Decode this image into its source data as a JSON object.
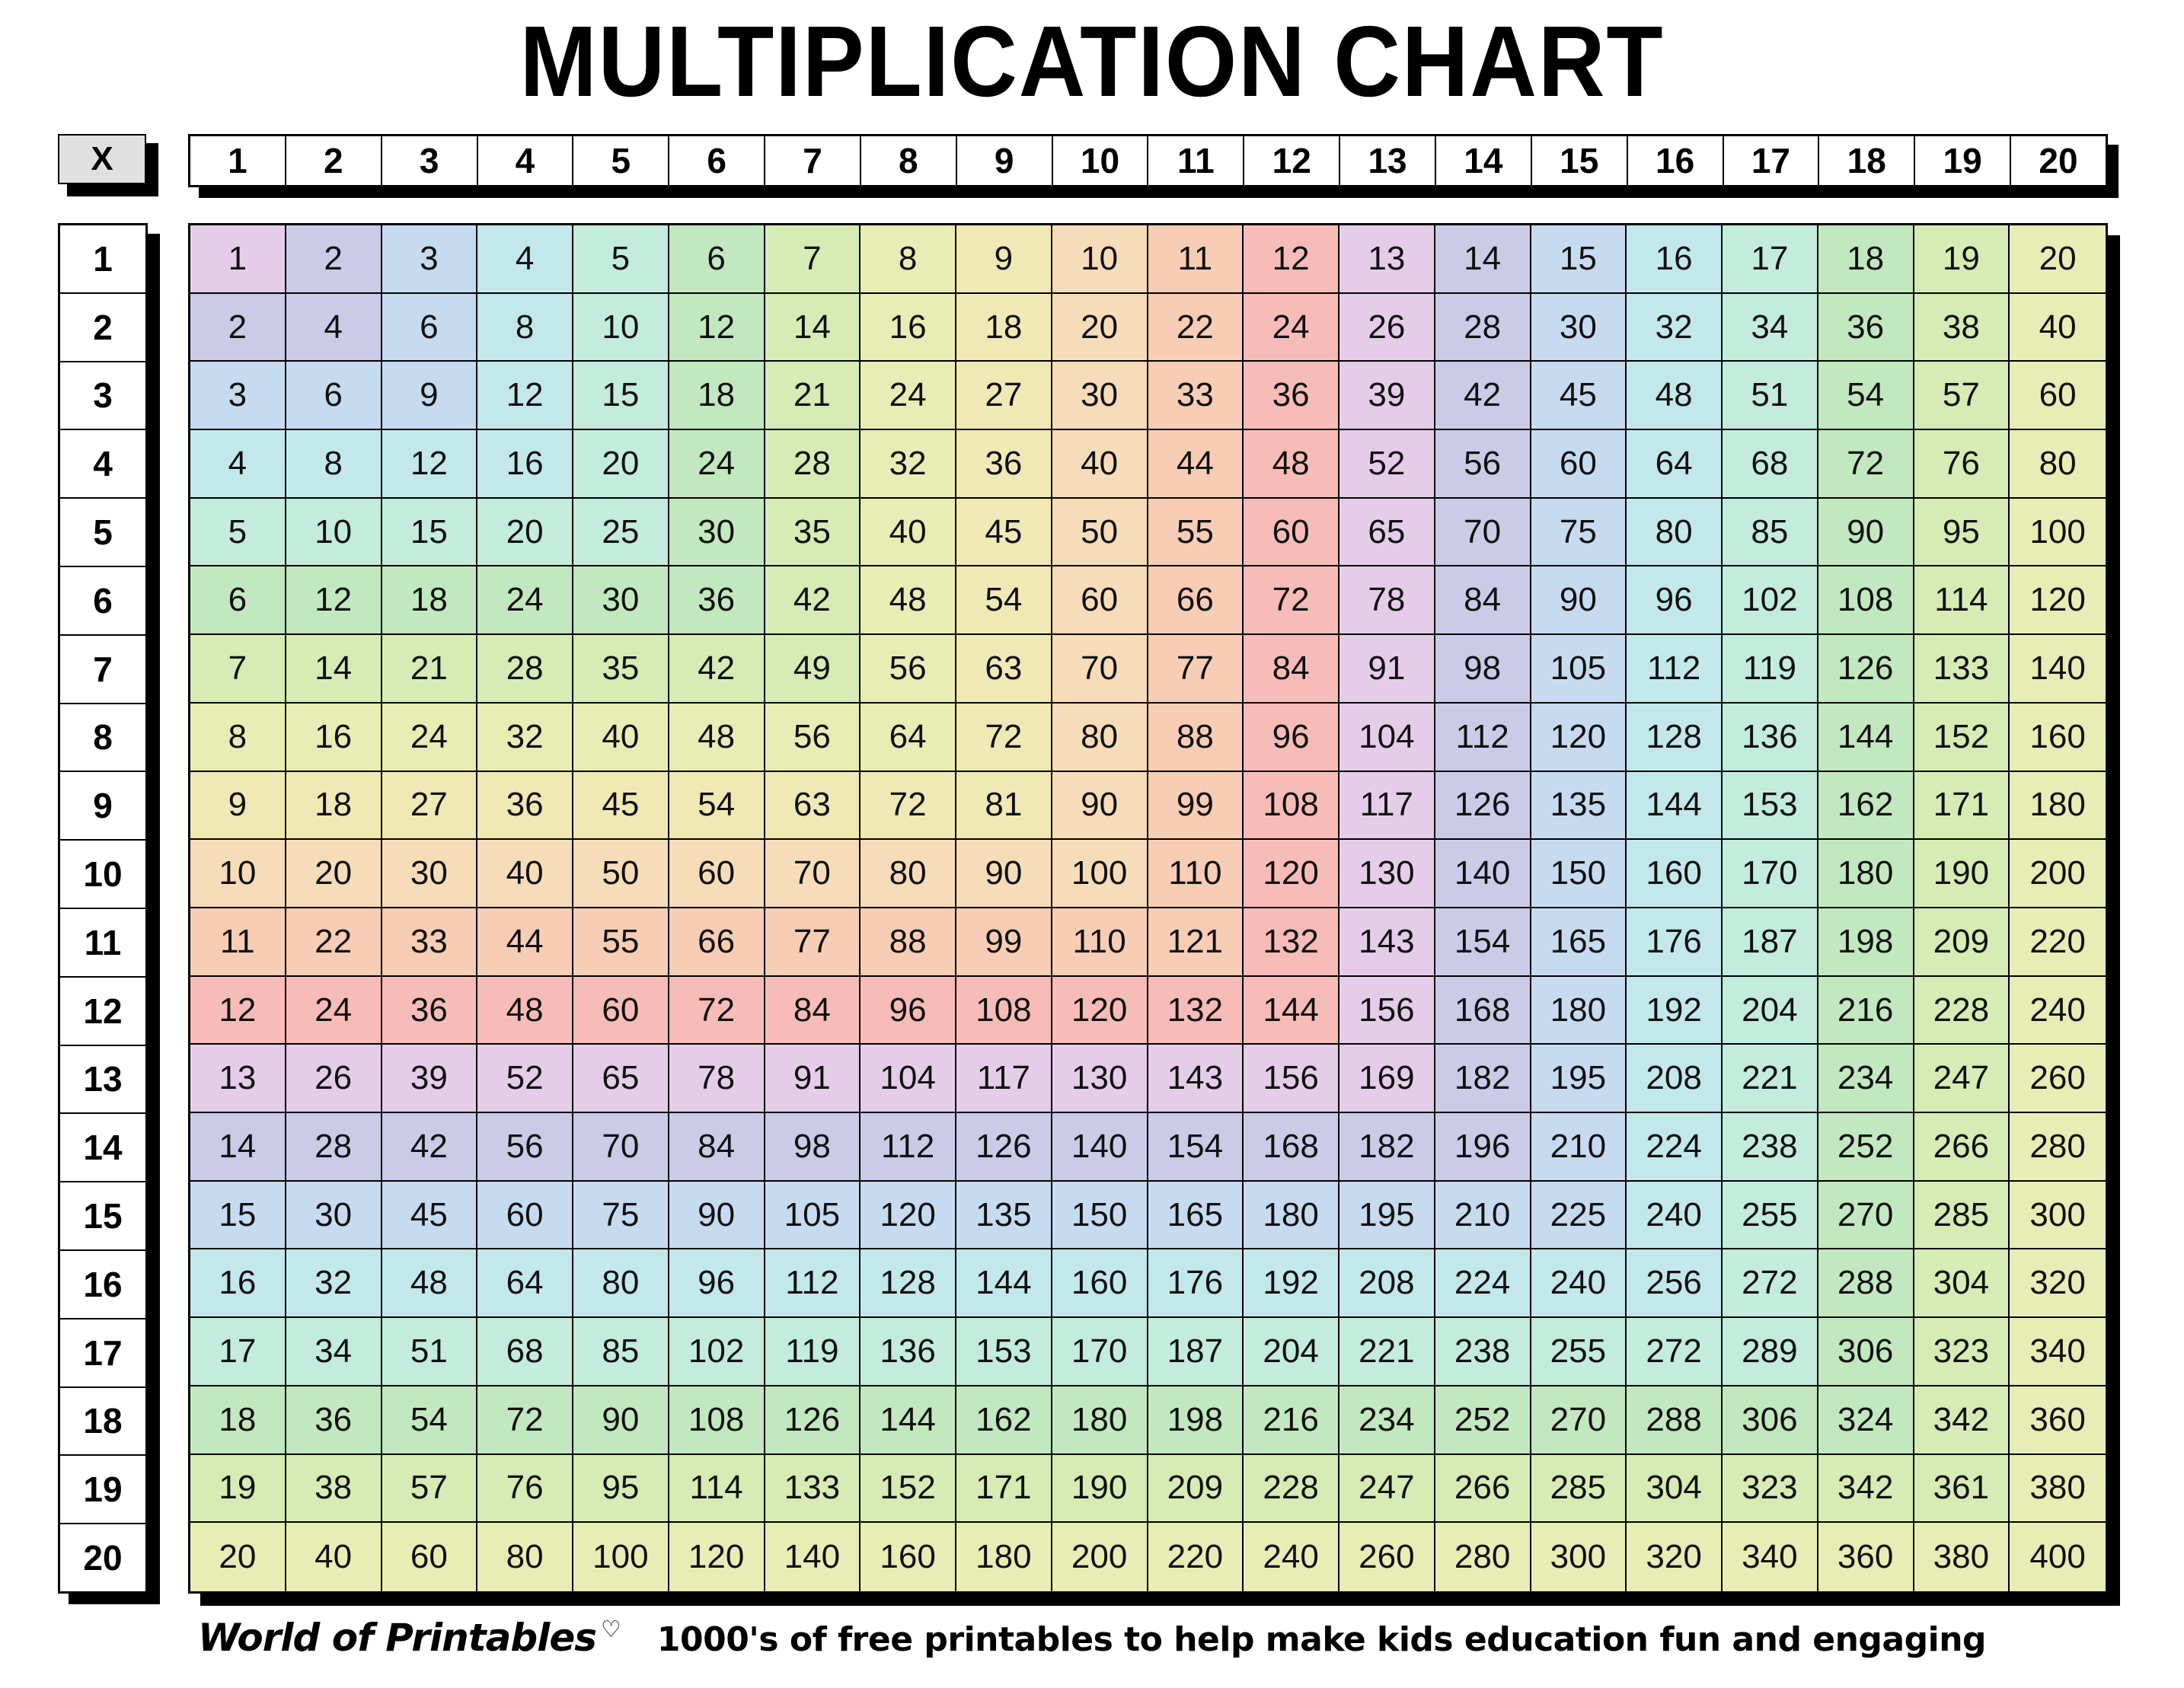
{
  "title": "MULTIPLICATION CHART",
  "corner_label": "X",
  "footer": {
    "brand": "World of Printables",
    "heart_icon": "♡",
    "tagline": "1000's of free printables to help make kids education fun and engaging"
  },
  "palette": {
    "corner_fill": "#e0e0e0",
    "header_fill": "#ffffff",
    "border": "#000000",
    "shadow": "#000000",
    "rainbow": [
      "#e5cdea",
      "#cbcbe8",
      "#c7dbf0",
      "#c3e8ec",
      "#c3ecdc",
      "#c2e8bf",
      "#d6ecb4",
      "#e8edb6",
      "#f0e9b6",
      "#f7dcb9",
      "#f8cdb5",
      "#f8bcb8"
    ]
  },
  "chart_data": {
    "type": "table",
    "title": "MULTIPLICATION CHART",
    "xlabel": "",
    "ylabel": "",
    "corner_label": "X",
    "grid": true,
    "legend": "none",
    "color_rule": "cell background index = max(row, col) mod 12 over a 12-step pastel rainbow",
    "columns": [
      1,
      2,
      3,
      4,
      5,
      6,
      7,
      8,
      9,
      10,
      11,
      12,
      13,
      14,
      15,
      16,
      17,
      18,
      19,
      20
    ],
    "rows": [
      1,
      2,
      3,
      4,
      5,
      6,
      7,
      8,
      9,
      10,
      11,
      12,
      13,
      14,
      15,
      16,
      17,
      18,
      19,
      20
    ],
    "values": [
      [
        1,
        2,
        3,
        4,
        5,
        6,
        7,
        8,
        9,
        10,
        11,
        12,
        13,
        14,
        15,
        16,
        17,
        18,
        19,
        20
      ],
      [
        2,
        4,
        6,
        8,
        10,
        12,
        14,
        16,
        18,
        20,
        22,
        24,
        26,
        28,
        30,
        32,
        34,
        36,
        38,
        40
      ],
      [
        3,
        6,
        9,
        12,
        15,
        18,
        21,
        24,
        27,
        30,
        33,
        36,
        39,
        42,
        45,
        48,
        51,
        54,
        57,
        60
      ],
      [
        4,
        8,
        12,
        16,
        20,
        24,
        28,
        32,
        36,
        40,
        44,
        48,
        52,
        56,
        60,
        64,
        68,
        72,
        76,
        80
      ],
      [
        5,
        10,
        15,
        20,
        25,
        30,
        35,
        40,
        45,
        50,
        55,
        60,
        65,
        70,
        75,
        80,
        85,
        90,
        95,
        100
      ],
      [
        6,
        12,
        18,
        24,
        30,
        36,
        42,
        48,
        54,
        60,
        66,
        72,
        78,
        84,
        90,
        96,
        102,
        108,
        114,
        120
      ],
      [
        7,
        14,
        21,
        28,
        35,
        42,
        49,
        56,
        63,
        70,
        77,
        84,
        91,
        98,
        105,
        112,
        119,
        126,
        133,
        140
      ],
      [
        8,
        16,
        24,
        32,
        40,
        48,
        56,
        64,
        72,
        80,
        88,
        96,
        104,
        112,
        120,
        128,
        136,
        144,
        152,
        160
      ],
      [
        9,
        18,
        27,
        36,
        45,
        54,
        63,
        72,
        81,
        90,
        99,
        108,
        117,
        126,
        135,
        144,
        153,
        162,
        171,
        180
      ],
      [
        10,
        20,
        30,
        40,
        50,
        60,
        70,
        80,
        90,
        100,
        110,
        120,
        130,
        140,
        150,
        160,
        170,
        180,
        190,
        200
      ],
      [
        11,
        22,
        33,
        44,
        55,
        66,
        77,
        88,
        99,
        110,
        121,
        132,
        143,
        154,
        165,
        176,
        187,
        198,
        209,
        220
      ],
      [
        12,
        24,
        36,
        48,
        60,
        72,
        84,
        96,
        108,
        120,
        132,
        144,
        156,
        168,
        180,
        192,
        204,
        216,
        228,
        240
      ],
      [
        13,
        26,
        39,
        52,
        65,
        78,
        91,
        104,
        117,
        130,
        143,
        156,
        169,
        182,
        195,
        208,
        221,
        234,
        247,
        260
      ],
      [
        14,
        28,
        42,
        56,
        70,
        84,
        98,
        112,
        126,
        140,
        154,
        168,
        182,
        196,
        210,
        224,
        238,
        252,
        266,
        280
      ],
      [
        15,
        30,
        45,
        60,
        75,
        90,
        105,
        120,
        135,
        150,
        165,
        180,
        195,
        210,
        225,
        240,
        255,
        270,
        285,
        300
      ],
      [
        16,
        32,
        48,
        64,
        80,
        96,
        112,
        128,
        144,
        160,
        176,
        192,
        208,
        224,
        240,
        256,
        272,
        288,
        304,
        320
      ],
      [
        17,
        34,
        51,
        68,
        85,
        102,
        119,
        136,
        153,
        170,
        187,
        204,
        221,
        238,
        255,
        272,
        289,
        306,
        323,
        340
      ],
      [
        18,
        36,
        54,
        72,
        90,
        108,
        126,
        144,
        162,
        180,
        198,
        216,
        234,
        252,
        270,
        288,
        306,
        324,
        342,
        360
      ],
      [
        19,
        38,
        57,
        76,
        95,
        114,
        133,
        152,
        171,
        190,
        209,
        228,
        247,
        266,
        285,
        304,
        323,
        342,
        361,
        380
      ],
      [
        20,
        40,
        60,
        80,
        100,
        120,
        140,
        160,
        180,
        200,
        220,
        240,
        260,
        280,
        300,
        320,
        340,
        360,
        380,
        400
      ]
    ]
  }
}
